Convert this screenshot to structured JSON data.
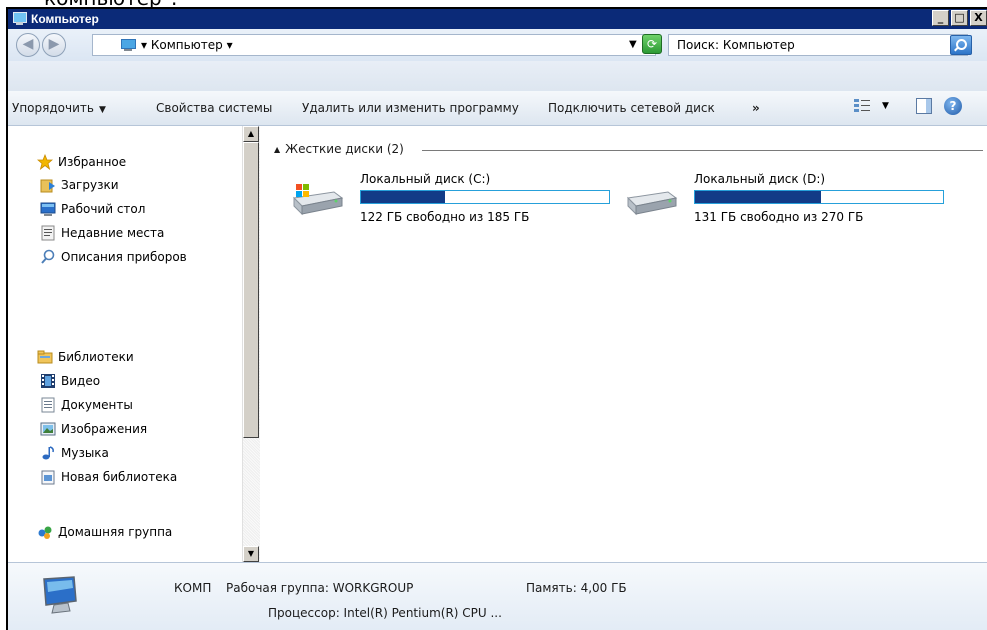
{
  "window": {
    "title": "Компьютер",
    "min_label": "_",
    "max_label": "□",
    "close_label": "X"
  },
  "address": {
    "path": "▾ Компьютер ▾",
    "search_placeholder": "Поиск: Компьютер"
  },
  "toolbar": {
    "organize": "Упорядочить",
    "system_properties": "Свойства системы",
    "uninstall": "Удалить или изменить программу",
    "map_drive": "Подключить сетевой диск",
    "more": "»"
  },
  "sidebar": {
    "favorites": {
      "label": "Избранное",
      "items": [
        "Загрузки",
        "Рабочий стол",
        "Недавние места",
        "Описания приборов"
      ]
    },
    "libraries": {
      "label": "Библиотеки",
      "items": [
        "Видео",
        "Документы",
        "Изображения",
        "Музыка",
        "Новая библиотека"
      ]
    },
    "homegroup": "Домашняя группа"
  },
  "content": {
    "group_header": "Жесткие диски (2)",
    "drives": [
      {
        "name": "Локальный диск (C:)",
        "free_text": "122 ГБ свободно из 185 ГБ",
        "used_fraction": 0.34
      },
      {
        "name": "Локальный диск (D:)",
        "free_text": "131 ГБ свободно из 270 ГБ",
        "used_fraction": 0.51
      }
    ]
  },
  "details": {
    "computer_name": "КОМП",
    "workgroup": "Рабочая группа: WORKGROUP",
    "memory": "Память: 4,00 ГБ",
    "processor": "Процессор: Intel(R) Pentium(R) CPU ..."
  },
  "top_cut_text": "компьютер\".",
  "colors": {
    "titlebar": "#0b2a78",
    "drive_fill": "#123b87",
    "drive_border": "#26a0da"
  }
}
